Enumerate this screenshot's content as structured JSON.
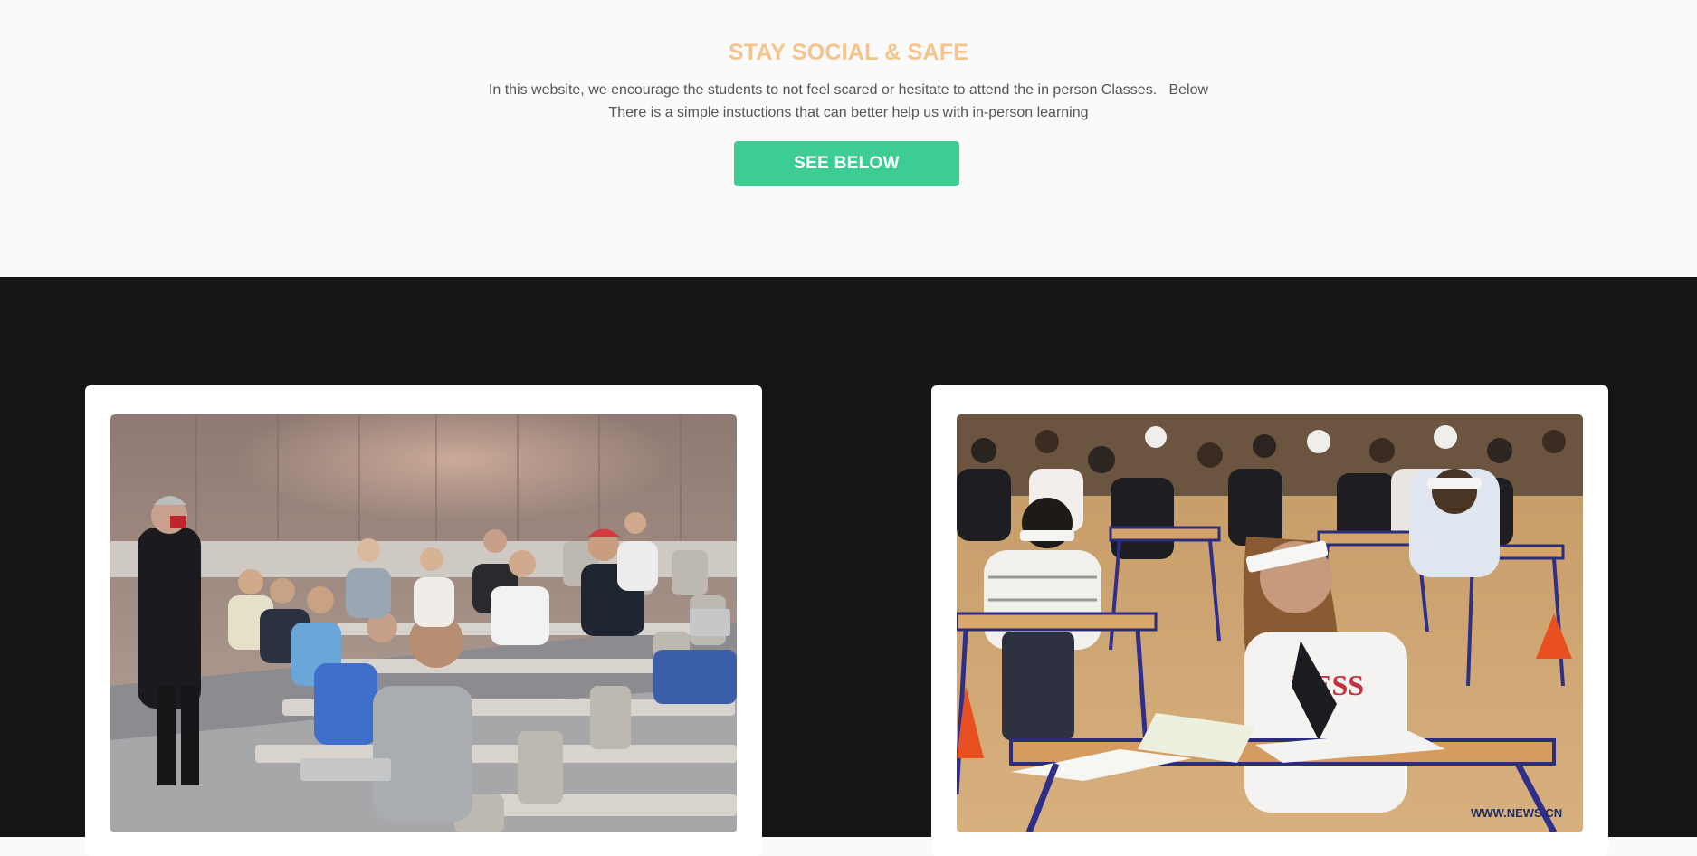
{
  "hero": {
    "title": "STAY SOCIAL & SAFE",
    "text_line1": "In this website, we encourage the students to not feel scared or hesitate to attend the in person Classes.   Below",
    "text_line2": "There is a simple instuctions that can better help us with in-person learning",
    "button_label": "SEE BELOW"
  },
  "cards": [
    {
      "image": "lecture-hall-masked-students-photo"
    },
    {
      "image": "exam-hall-face-shield-students-photo",
      "watermark": "WWW.NEWS.CN"
    }
  ],
  "colors": {
    "title": "#f6c48b",
    "button": "#3ccd92",
    "dark_bg": "#151515",
    "hero_bg": "#fafafa"
  }
}
